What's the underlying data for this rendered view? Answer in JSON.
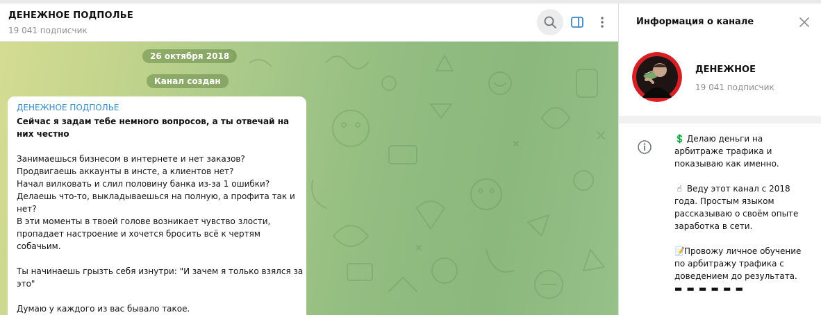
{
  "chat": {
    "title": "ДЕНЕЖНОЕ ПОДПОЛЬЕ",
    "subscribers": "19 041 подписчик"
  },
  "service": {
    "date": "26 октября 2018",
    "created": "Канал создан"
  },
  "message": {
    "sender": "ДЕНЕЖНОЕ ПОДПОЛЬЕ",
    "headline": "Сейчас я задам тебе немного вопросов, а ты отвечай на них честно",
    "lines": [
      "Занимаешься бизнесом в интернете и нет заказов?",
      "Продвигаешь аккаунты в инсте, а клиентов нет?",
      "Начал вилковать и слил половину банка из-за 1 ошибки?",
      "Делаешь что-то, выкладываешься на полную, а профита так и",
      "нет?",
      "В эти моменты в твоей голове возникает чувство злости,",
      "пропадает настроение и хочется бросить всё к чертям",
      "собачьим.",
      "",
      "Ты начинаешь грызть себя изнутри: \"И зачем я только взялся за",
      "это\"",
      "",
      "Думаю у каждого из вас бывало такое."
    ]
  },
  "side": {
    "title": "Информация о канале",
    "channel_name": "ДЕНЕЖНОЕ",
    "subscribers": "19 041 подписчик",
    "about": {
      "p1_emoji": "💲",
      "p1": "Делаю деньги на арбитраже трафика и показываю как именно.",
      "p2_emoji": "☝",
      "p2": "Веду этот канал с 2018 года. Простым языком рассказываю о своём опыте заработка в сети.",
      "p3_emoji": "📝",
      "p3": "Провожу личное обучение по арбитражу трафика с доведением до результата.",
      "dashes": "▬ ▬ ▬ ▬ ▬ ▬"
    }
  },
  "icons": {
    "search": "search-icon",
    "side_panel": "side-panel-icon",
    "more": "more-vertical-icon",
    "close": "close-icon",
    "info": "info-icon"
  },
  "colors": {
    "accent": "#3a8ac4",
    "pill": "#719250",
    "avatar_ring": "#d71f26"
  }
}
